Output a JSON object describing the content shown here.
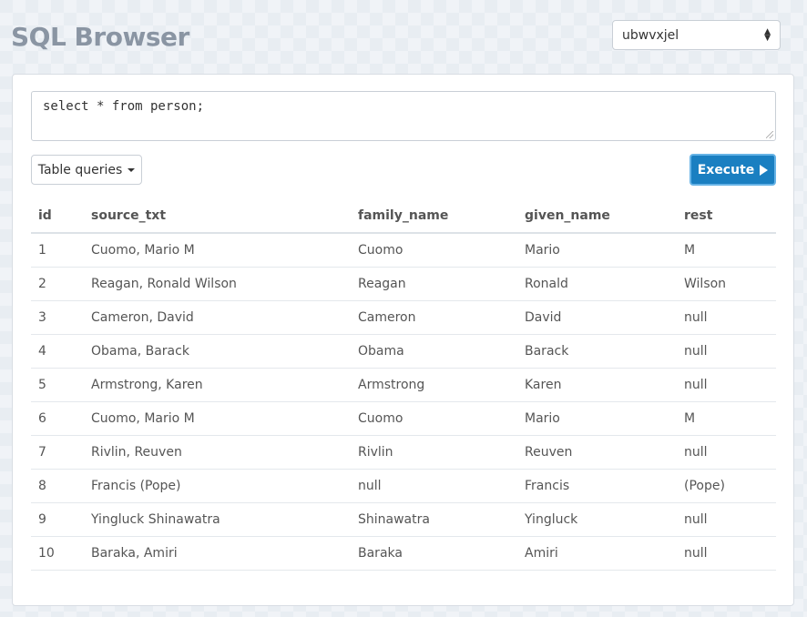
{
  "app": {
    "title": "SQL Browser"
  },
  "db_select": {
    "value": "ubwvxjel"
  },
  "query": {
    "text": "select * from person;"
  },
  "toolbar": {
    "table_queries_label": "Table queries",
    "execute_label": "Execute"
  },
  "results": {
    "columns": [
      "id",
      "source_txt",
      "family_name",
      "given_name",
      "rest"
    ],
    "rows": [
      [
        "1",
        "Cuomo, Mario M",
        "Cuomo",
        "Mario",
        "M"
      ],
      [
        "2",
        "Reagan, Ronald Wilson",
        "Reagan",
        "Ronald",
        "Wilson"
      ],
      [
        "3",
        "Cameron, David",
        "Cameron",
        "David",
        "null"
      ],
      [
        "4",
        "Obama, Barack",
        "Obama",
        "Barack",
        "null"
      ],
      [
        "5",
        "Armstrong, Karen",
        "Armstrong",
        "Karen",
        "null"
      ],
      [
        "6",
        "Cuomo, Mario M",
        "Cuomo",
        "Mario",
        "M"
      ],
      [
        "7",
        "Rivlin, Reuven",
        "Rivlin",
        "Reuven",
        "null"
      ],
      [
        "8",
        "Francis (Pope)",
        "null",
        "Francis",
        "(Pope)"
      ],
      [
        "9",
        "Yingluck Shinawatra",
        "Shinawatra",
        "Yingluck",
        "null"
      ],
      [
        "10",
        "Baraka, Amiri",
        "Baraka",
        "Amiri",
        "null"
      ]
    ]
  },
  "colors": {
    "execute_bg": "#1a7fc1",
    "title": "#8a95a3"
  }
}
